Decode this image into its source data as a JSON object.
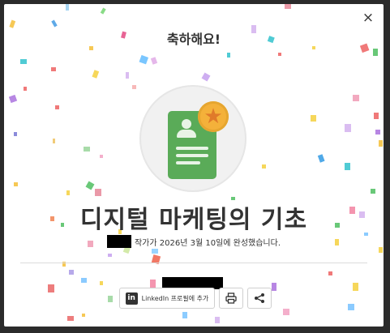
{
  "dialog": {
    "title": "축하해요!",
    "close_label": "×",
    "course_title": "디지털 마케팅의 기초",
    "completion_text": "작가가 2026년 3월 10일에 완성했습니다."
  },
  "actions": {
    "linkedin_label": "LinkedIn 프로필에 추가",
    "linkedin_icon": "linkedin-icon",
    "print_icon": "print-icon",
    "share_icon": "share-icon"
  },
  "badge": {
    "icon": "certificate-icon",
    "star_icon": "star-icon",
    "star_glyph": "★"
  },
  "colors": {
    "certificate_green": "#5aab58",
    "star_gold": "#f4b13a"
  }
}
